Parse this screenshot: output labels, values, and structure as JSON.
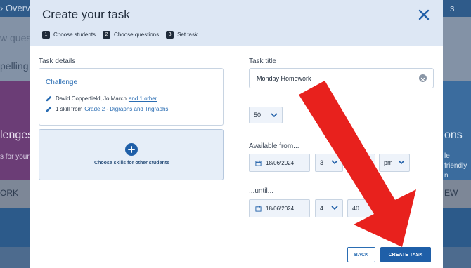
{
  "background": {
    "top_left_text": "› Overvi",
    "top_right_text": "s",
    "questions_fragment": "w questio",
    "spelling_fragment": "pelling –",
    "challenges_fragment": "lenges",
    "for_your_fragment": "s for your",
    "right_heading_fragment": "ons",
    "right_sub_fragment_1": "le friendly",
    "right_sub_fragment_2": "n teams.",
    "work_fragment": "ORK",
    "new_fragment": "EW"
  },
  "modal": {
    "title": "Create your task",
    "steps": [
      {
        "num": "1",
        "label": "Choose students"
      },
      {
        "num": "2",
        "label": "Choose questions"
      },
      {
        "num": "3",
        "label": "Set task"
      }
    ],
    "task_details": {
      "label": "Task details",
      "heading": "Challenge",
      "students_text": "David Copperfield, Jo March",
      "students_link": "and 1 other",
      "skills_text": "1 skill from",
      "skills_link": "Grade 2 - Digraphs and Trigraphs"
    },
    "choose_skills_label": "Choose skills for other students",
    "task_title": {
      "label": "Task title",
      "value": "Monday Homework"
    },
    "questions": {
      "count": "50",
      "suffix": "questio"
    },
    "available_from": {
      "label": "Available from...",
      "date": "18/06/2024",
      "hour": "3",
      "ampm": "pm"
    },
    "until": {
      "label": "...until...",
      "date": "18/06/2024",
      "hour": "4",
      "minute": "40"
    },
    "back_label": "BACK",
    "create_label": "CREATE TASK"
  },
  "colors": {
    "accent": "#1f5fa8",
    "arrow": "#e8211d"
  }
}
